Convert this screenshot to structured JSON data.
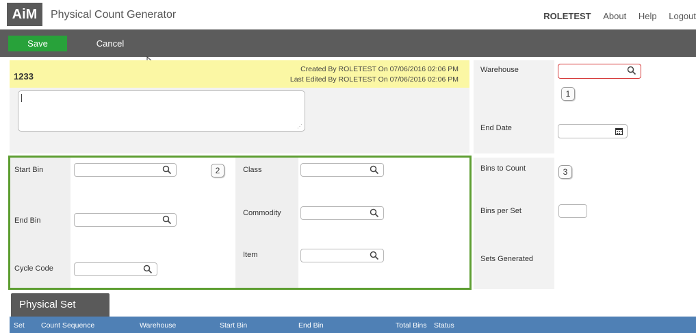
{
  "header": {
    "logo": "AiM",
    "title": "Physical Count Generator",
    "nav": {
      "user": "ROLETEST",
      "about": "About",
      "help": "Help",
      "logout": "Logout"
    }
  },
  "toolbar": {
    "save_label": "Save",
    "cancel_label": "Cancel"
  },
  "record": {
    "id": "1233",
    "created": "Created By ROLETEST On 07/06/2016 02:06 PM",
    "edited": "Last Edited By ROLETEST On 07/06/2016 02:06 PM",
    "description": ""
  },
  "right_top": {
    "warehouse_label": "Warehouse",
    "warehouse_value": "",
    "end_date_label": "End Date",
    "end_date_value": "",
    "badge": "1"
  },
  "filters": {
    "start_bin_label": "Start Bin",
    "end_bin_label": "End Bin",
    "cycle_code_label": "Cycle Code",
    "class_label": "Class",
    "commodity_label": "Commodity",
    "item_label": "Item",
    "badge": "2"
  },
  "right_bottom": {
    "bins_to_count_label": "Bins to Count",
    "bins_per_set_label": "Bins per Set",
    "sets_generated_label": "Sets Generated",
    "badge": "3"
  },
  "physical_set": {
    "tab_label": "Physical Set",
    "columns": [
      "Set",
      "Count Sequence",
      "Warehouse",
      "Start Bin",
      "End Bin",
      "Total Bins",
      "Status"
    ]
  },
  "colors": {
    "save_green": "#28a23a",
    "toolbar_gray": "#5c5c5c",
    "record_yellow": "#fbf7a4",
    "filter_border_green": "#5e9e32",
    "required_red": "#d63b3b",
    "table_header_blue": "#4f80b5"
  },
  "icons": {
    "lookup": "search-icon",
    "date": "calendar-icon",
    "pointer": "mouse-cursor-icon"
  }
}
